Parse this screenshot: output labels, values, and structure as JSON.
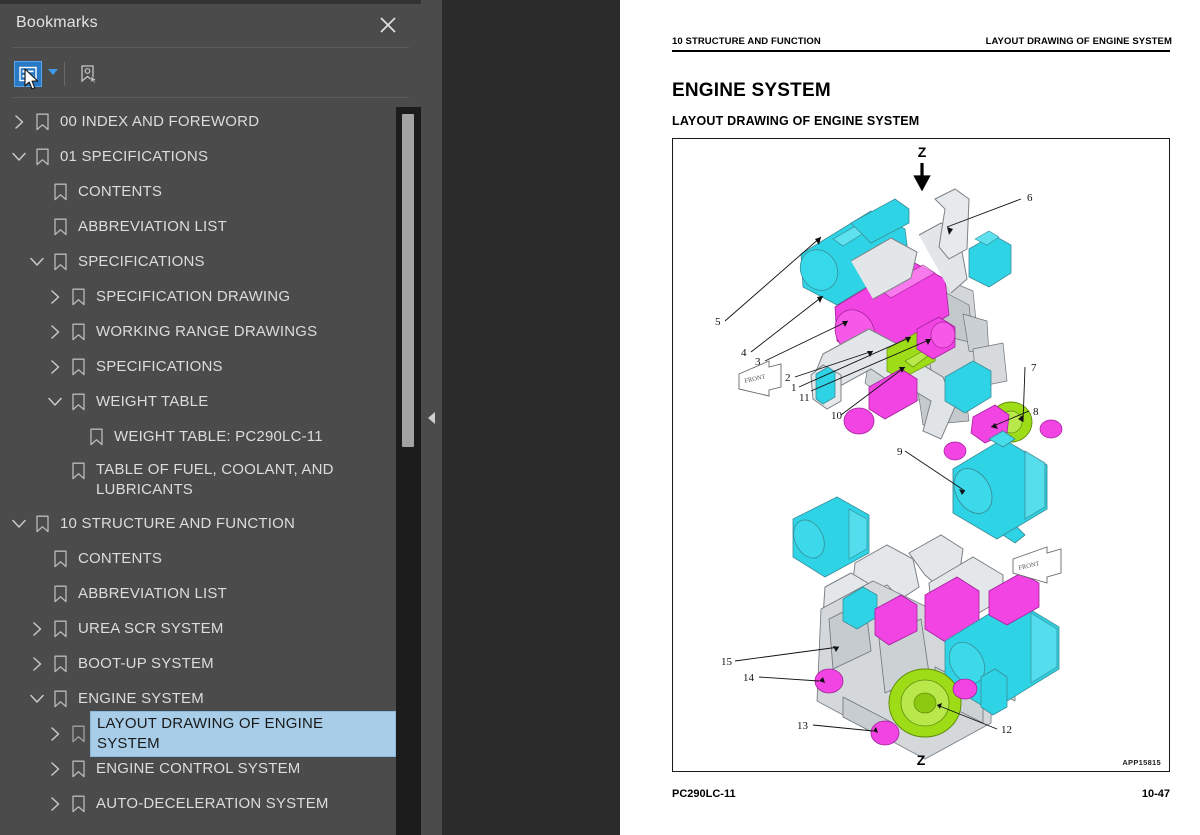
{
  "panel": {
    "title": "Bookmarks",
    "close_icon": "close-icon",
    "toolbar": {
      "list_options_icon": "bookmark-list-options-icon",
      "dropdown_icon": "chevron-down-icon",
      "new_bookmark_icon": "new-bookmark-icon"
    },
    "collapse_icon": "collapse-left-icon"
  },
  "tree": [
    {
      "label": "00 INDEX AND FOREWORD",
      "indent": 0,
      "twisty": "collapsed",
      "selected": false,
      "lines": 1
    },
    {
      "label": "01 SPECIFICATIONS",
      "indent": 0,
      "twisty": "expanded",
      "selected": false,
      "lines": 1
    },
    {
      "label": "CONTENTS",
      "indent": 1,
      "twisty": "none",
      "selected": false,
      "lines": 1
    },
    {
      "label": "ABBREVIATION LIST",
      "indent": 1,
      "twisty": "none",
      "selected": false,
      "lines": 1
    },
    {
      "label": "SPECIFICATIONS",
      "indent": 1,
      "twisty": "expanded",
      "selected": false,
      "lines": 1
    },
    {
      "label": "SPECIFICATION DRAWING",
      "indent": 2,
      "twisty": "collapsed",
      "selected": false,
      "lines": 1
    },
    {
      "label": "WORKING RANGE DRAWINGS",
      "indent": 2,
      "twisty": "collapsed",
      "selected": false,
      "lines": 1
    },
    {
      "label": "SPECIFICATIONS",
      "indent": 2,
      "twisty": "collapsed",
      "selected": false,
      "lines": 1
    },
    {
      "label": "WEIGHT TABLE",
      "indent": 2,
      "twisty": "expanded",
      "selected": false,
      "lines": 1
    },
    {
      "label": "WEIGHT TABLE: PC290LC-11",
      "indent": 3,
      "twisty": "none",
      "selected": false,
      "lines": 1
    },
    {
      "label": "TABLE OF FUEL, COOLANT, AND LUBRICANTS",
      "indent": 2,
      "twisty": "none",
      "selected": false,
      "lines": 2
    },
    {
      "label": "10 STRUCTURE AND FUNCTION",
      "indent": 0,
      "twisty": "expanded",
      "selected": false,
      "lines": 1
    },
    {
      "label": "CONTENTS",
      "indent": 1,
      "twisty": "none",
      "selected": false,
      "lines": 1
    },
    {
      "label": "ABBREVIATION LIST",
      "indent": 1,
      "twisty": "none",
      "selected": false,
      "lines": 1
    },
    {
      "label": "UREA SCR SYSTEM",
      "indent": 1,
      "twisty": "collapsed",
      "selected": false,
      "lines": 1
    },
    {
      "label": "BOOT-UP SYSTEM",
      "indent": 1,
      "twisty": "collapsed",
      "selected": false,
      "lines": 1
    },
    {
      "label": "ENGINE SYSTEM",
      "indent": 1,
      "twisty": "expanded",
      "selected": false,
      "lines": 1
    },
    {
      "label": "LAYOUT DRAWING OF ENGINE SYSTEM",
      "indent": 2,
      "twisty": "collapsed",
      "selected": true,
      "lines": 1
    },
    {
      "label": "ENGINE CONTROL SYSTEM",
      "indent": 2,
      "twisty": "collapsed",
      "selected": false,
      "lines": 1
    },
    {
      "label": "AUTO-DECELERATION SYSTEM",
      "indent": 2,
      "twisty": "collapsed",
      "selected": false,
      "lines": 1
    }
  ],
  "document": {
    "header_left": "10 STRUCTURE AND FUNCTION",
    "header_right": "LAYOUT DRAWING OF ENGINE SYSTEM",
    "title": "ENGINE SYSTEM",
    "subtitle": "LAYOUT DRAWING OF ENGINE SYSTEM",
    "figure_id": "APP15815",
    "footer_left": "PC290LC-11",
    "footer_right": "10-47",
    "figure": {
      "top_view_marker": "Z",
      "bottom_view_marker": "Z",
      "orientation_label": "FRONT",
      "callouts_top": [
        "1",
        "2",
        "3",
        "4",
        "5",
        "6",
        "7",
        "8",
        "9",
        "10",
        "11"
      ],
      "callouts_bottom": [
        "12",
        "13",
        "14",
        "15"
      ],
      "colors": {
        "cyan": "#28d7e8",
        "magenta": "#f03ce0",
        "green": "#9ddb17",
        "gray": "#c9cdd1",
        "outline": "#6d7378"
      }
    }
  }
}
